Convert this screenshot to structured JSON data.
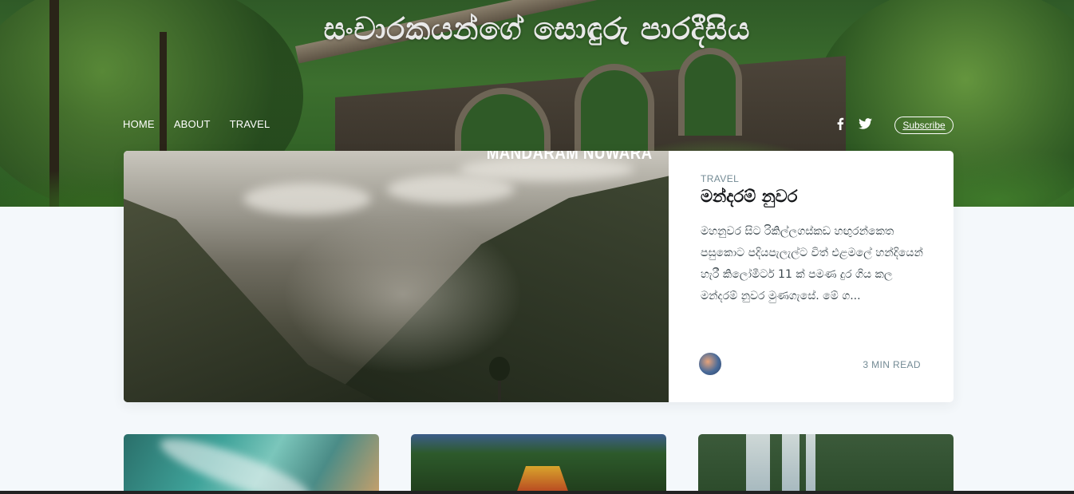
{
  "site": {
    "title": "සංචාරකයන්ගේ සොඳුරු පාරදීසිය"
  },
  "nav": {
    "items": [
      {
        "label": "HOME"
      },
      {
        "label": "ABOUT"
      },
      {
        "label": "TRAVEL"
      }
    ],
    "subscribe_label": "Subscribe",
    "social": [
      "facebook-icon",
      "twitter-icon"
    ]
  },
  "featured": {
    "image_caption": "MANDARAM NUWARA",
    "tag": "TRAVEL",
    "title": "මන්දරම් නුවර",
    "excerpt": "මහනුවර සිට රිකිල්ලගස්කඩ හඟුරන්කෙත පසුකොට පදියපැලැල්ට විත් එළමලේ හන්දියෙන් හැරී කිලෝමීටර් 11 ක් පමණ දුර ගිය කල මන්දරම් නුවර මුණගැසේ. මේ ග...",
    "read_time": "3 MIN READ"
  },
  "colors": {
    "accent_text": "#738a94",
    "page_bg": "#f4f8fb",
    "title_text": "#15171a"
  }
}
